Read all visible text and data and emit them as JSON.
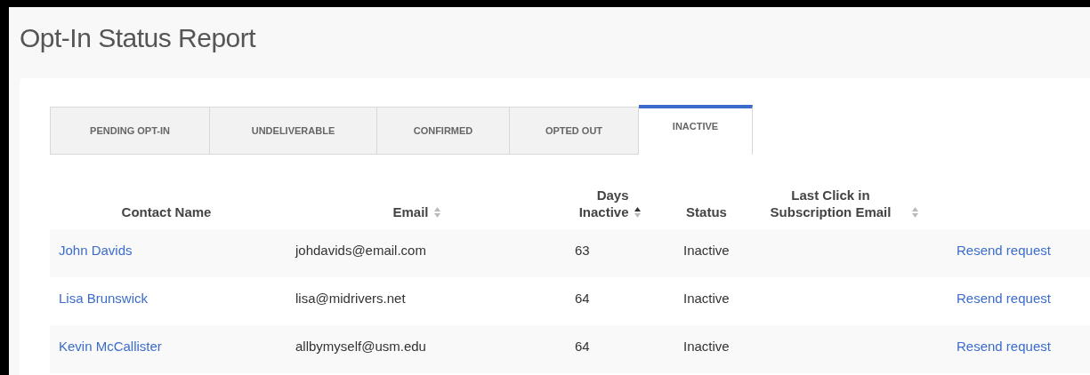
{
  "page": {
    "title": "Opt-In Status Report"
  },
  "tabs": [
    {
      "label": "PENDING OPT-IN",
      "selected": false
    },
    {
      "label": "UNDELIVERABLE",
      "selected": false
    },
    {
      "label": "CONFIRMED",
      "selected": false
    },
    {
      "label": "OPTED OUT",
      "selected": false
    },
    {
      "label": "INACTIVE",
      "selected": true
    }
  ],
  "table": {
    "columns": [
      {
        "label": "Contact Name",
        "kind": "plain",
        "sorted": false
      },
      {
        "label": "Email",
        "kind": "sortable",
        "sorted": false
      },
      {
        "label": "Days Inactive",
        "kind": "sortable",
        "sorted": true
      },
      {
        "label": "Status",
        "kind": "plain",
        "sorted": false
      },
      {
        "label": "Last Click in Subscription Email",
        "kind": "sortable",
        "sorted": false
      }
    ],
    "rows": [
      {
        "name": "John Davids",
        "email": "johdavids@email.com",
        "days": "63",
        "status": "Inactive",
        "action": "Resend request"
      },
      {
        "name": "Lisa Brunswick",
        "email": "lisa@midrivers.net",
        "days": "64",
        "status": "Inactive",
        "action": "Resend request"
      },
      {
        "name": "Kevin McCallister",
        "email": "allbymyself@usm.edu",
        "days": "64",
        "status": "Inactive",
        "action": "Resend request"
      }
    ]
  }
}
